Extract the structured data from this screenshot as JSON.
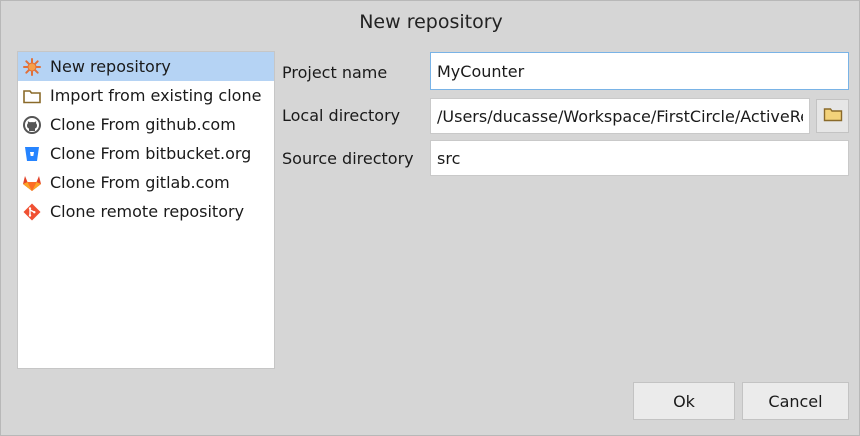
{
  "dialog": {
    "title": "New repository"
  },
  "sidebar": {
    "items": [
      {
        "label": "New repository",
        "icon": "new-repository-icon",
        "selected": true
      },
      {
        "label": "Import from existing clone",
        "icon": "folder-icon",
        "selected": false
      },
      {
        "label": "Clone From github.com",
        "icon": "github-icon",
        "selected": false
      },
      {
        "label": "Clone From bitbucket.org",
        "icon": "bitbucket-icon",
        "selected": false
      },
      {
        "label": "Clone From gitlab.com",
        "icon": "gitlab-icon",
        "selected": false
      },
      {
        "label": "Clone remote repository",
        "icon": "git-icon",
        "selected": false
      }
    ]
  },
  "form": {
    "project_name": {
      "label": "Project name",
      "value": "MyCounter"
    },
    "local_directory": {
      "label": "Local directory",
      "value": "/Users/ducasse/Workspace/FirstCircle/ActiveResearch"
    },
    "source_directory": {
      "label": "Source directory",
      "value": "src"
    }
  },
  "buttons": {
    "ok": "Ok",
    "cancel": "Cancel"
  },
  "colors": {
    "selection": "#b5d3f4",
    "focus_border": "#79b3e6",
    "background": "#d6d6d6"
  }
}
